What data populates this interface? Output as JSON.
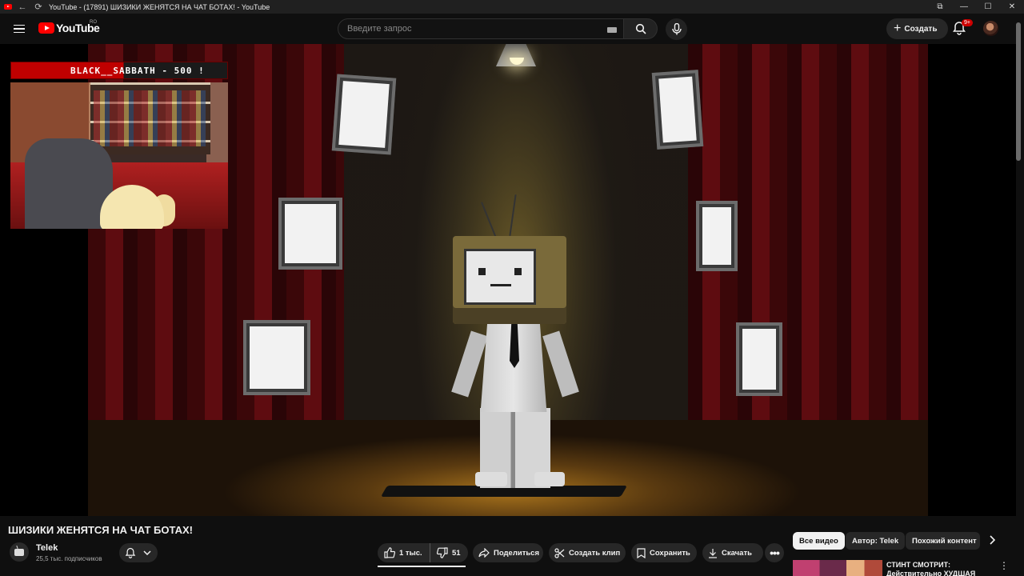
{
  "window": {
    "title": "YouTube - (17891) ШИЗИКИ ЖЕНЯТСЯ НА ЧАТ БОТАХ! - YouTube",
    "controls": [
      "—",
      "☐",
      "✕"
    ]
  },
  "masthead": {
    "logo_text": "YouTube",
    "region": "RO",
    "search_placeholder": "Введите запрос",
    "create_label": "Создать",
    "notifications_badge": "9+"
  },
  "video": {
    "overlay_banner": "BLACK__SABBATH - 500 !",
    "title": "ШИЗИКИ ЖЕНЯТСЯ НА ЧАТ БОТАХ!"
  },
  "channel": {
    "name": "Telek",
    "subscribers": "25,5 тыс. подписчиков"
  },
  "actions": {
    "likes": "1 тыс.",
    "dislikes": "51",
    "share": "Поделиться",
    "clip": "Создать клип",
    "save": "Сохранить",
    "download": "Скачать",
    "more": "•••"
  },
  "chips": [
    "Все видео",
    "Автор: Telek",
    "Похожий контент"
  ],
  "recommendation": {
    "title": "СТИНТ СМОТРИТ: Действительно ХУДШАЯ"
  },
  "colors": {
    "background": "#0f0f0f",
    "brand_red": "#ff0000",
    "pill": "#272727",
    "text": "#f1f1f1"
  },
  "icons": [
    "menu-icon",
    "youtube-logo-icon",
    "keyboard-icon",
    "search-icon",
    "mic-icon",
    "plus-icon",
    "bell-icon",
    "like-icon",
    "dislike-icon",
    "share-icon",
    "clip-icon",
    "save-icon",
    "download-icon",
    "chevron-right-icon"
  ]
}
